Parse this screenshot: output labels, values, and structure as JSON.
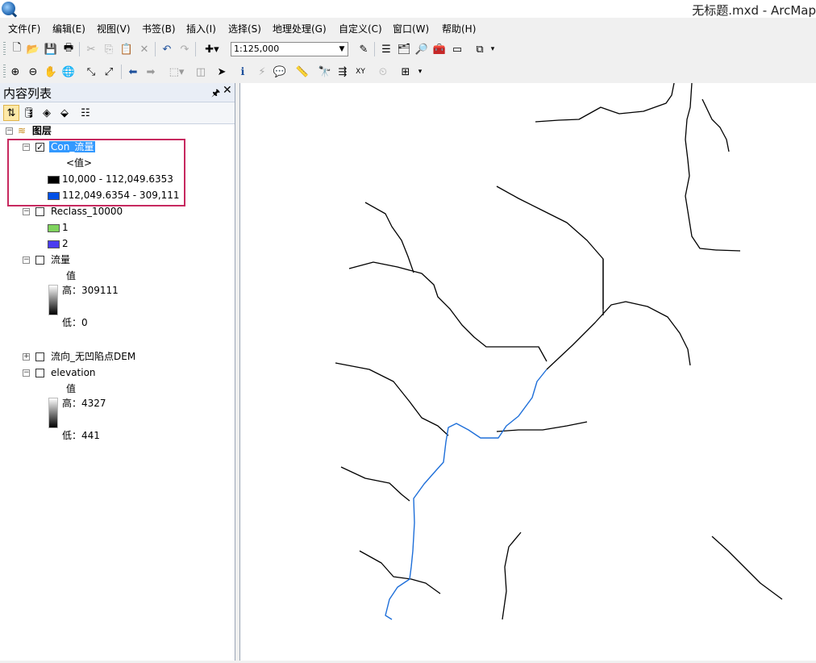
{
  "window": {
    "title": "无标题.mxd - ArcMap"
  },
  "menu": [
    "文件(F)",
    "编辑(E)",
    "视图(V)",
    "书签(B)",
    "插入(I)",
    "选择(S)",
    "地理处理(G)",
    "自定义(C)",
    "窗口(W)",
    "帮助(H)"
  ],
  "toolbar": {
    "scale_value": "1:125,000"
  },
  "toc": {
    "title": "内容列表",
    "pin_icon": "pin-icon",
    "close_icon": "close-icon",
    "root_label": "图层",
    "layers": [
      {
        "name": "Con_流量",
        "checked": true,
        "selected": true,
        "legend_heading": "<值>",
        "classes": [
          {
            "label": "10,000 - 112,049.6353",
            "color": "#000000"
          },
          {
            "label": "112,049.6354 - 309,111",
            "color": "#0050e6"
          }
        ]
      },
      {
        "name": "Reclass_10000",
        "checked": false,
        "classes": [
          {
            "label": "1",
            "color": "#7fd35d"
          },
          {
            "label": "2",
            "color": "#4a3cf0"
          }
        ]
      },
      {
        "name": "流量",
        "checked": false,
        "legend_heading": "值",
        "high": "高：309111",
        "low": "低：0"
      },
      {
        "name": "流向_无凹陷点DEM",
        "checked": false,
        "collapsed": true
      },
      {
        "name": "elevation",
        "checked": false,
        "legend_heading": "值",
        "high": "高：4327",
        "low": "低：441"
      }
    ]
  },
  "colors": {
    "selection": "#3399ff",
    "highlight_box": "#c7295f",
    "stream_black": "#000000",
    "stream_blue": "#1e6fd9"
  }
}
